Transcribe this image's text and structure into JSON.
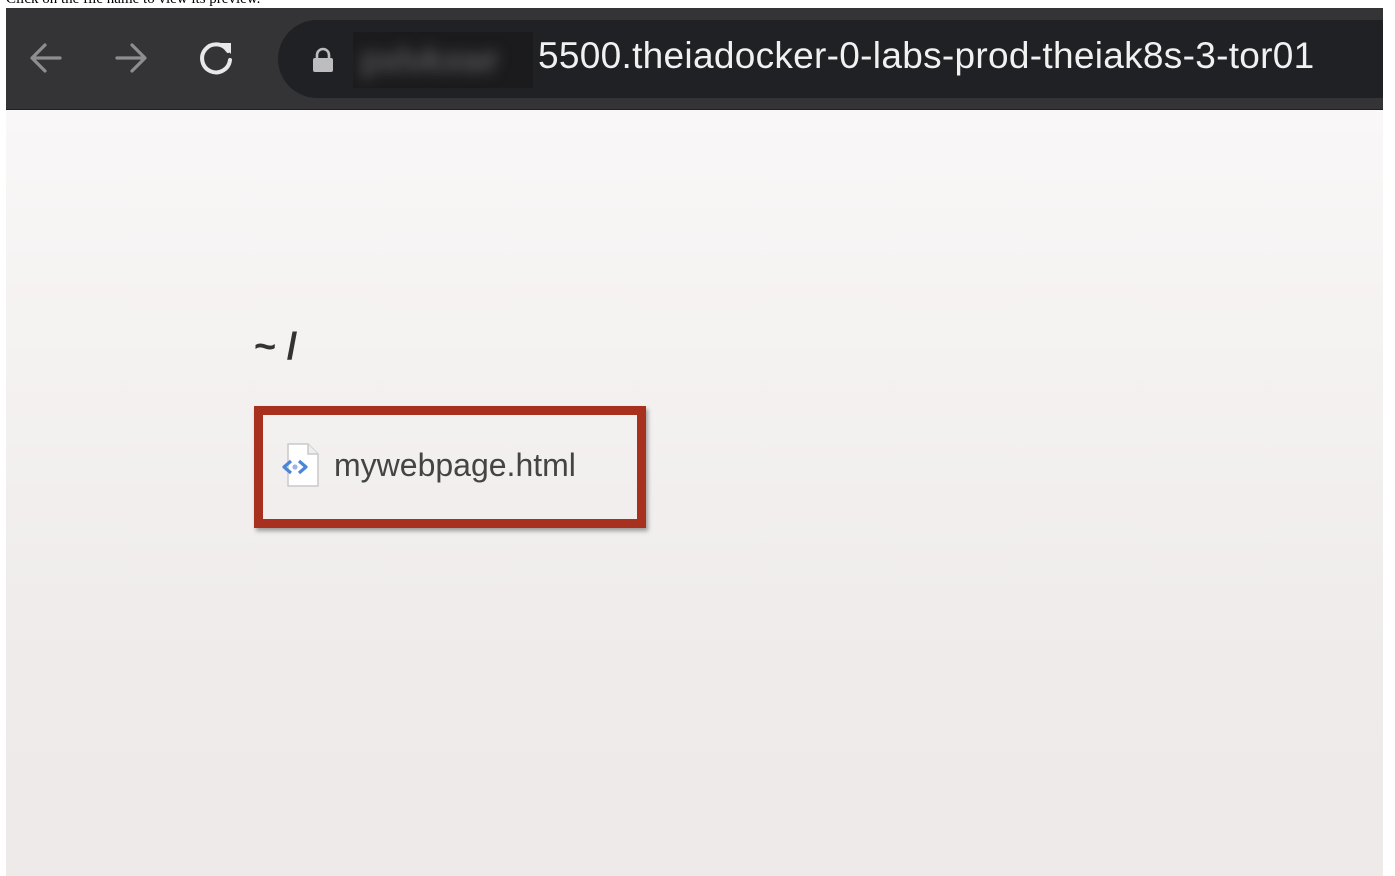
{
  "caption": "Click on the file name to view its preview.",
  "browser": {
    "back_icon": "arrow-left-icon",
    "forward_icon": "arrow-right-icon",
    "reload_icon": "reload-icon",
    "lock_icon": "lock-icon",
    "url_blurred_prefix": "pxlvkxwr",
    "url": "5500.theiadocker-0-labs-prod-theiak8s-3-tor01"
  },
  "listing": {
    "path": "~ /",
    "files": [
      {
        "name": "mywebpage.html",
        "icon": "html-file-icon"
      }
    ],
    "highlight_color": "#a8301f"
  }
}
